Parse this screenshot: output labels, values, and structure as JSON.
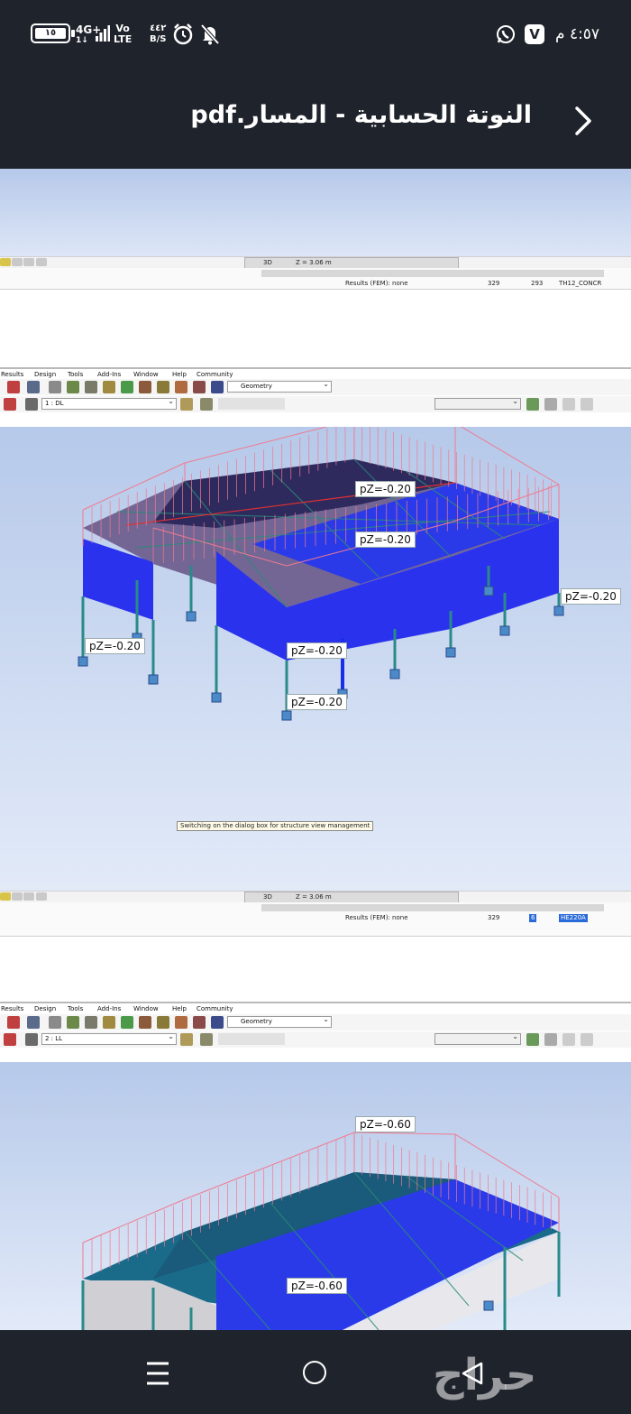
{
  "status_bar": {
    "battery": "١٥",
    "network_type": "4G+",
    "network_sub": "1↓",
    "volte_top": "Vo",
    "volte_bottom": "LTE",
    "speed_value": "٤٤٢",
    "speed_unit": "B/S",
    "clock": "٤:٥٧ م",
    "app_icons": [
      "whatsapp-icon",
      "v-app-icon"
    ],
    "left_icons": [
      "alarm-icon",
      "bell-off-icon"
    ]
  },
  "header": {
    "title": "النوتة الحسابية - المسار.pdf",
    "back_icon": "chevron-right-icon"
  },
  "doc": {
    "block1": {
      "tab_view": "3D",
      "tab_z": "Z = 3.06 m",
      "results": "Results (FEM): none",
      "num_a": "329",
      "num_b": "293",
      "section": "TH12_CONCR"
    },
    "menu": [
      "Results",
      "Design",
      "Tools",
      "Add-Ins",
      "Window",
      "Help",
      "Community"
    ],
    "geometry_combo": "Geometry",
    "block2": {
      "load_case": "1 : DL",
      "labels": [
        "pZ=-0.20",
        "pZ=-0.20",
        "pZ=-0.20",
        "pZ=-0.20",
        "pZ=-0.20",
        "pZ=-0.20"
      ],
      "tooltip": "Switching on the dialog box for structure view management",
      "tab_view": "3D",
      "tab_z": "Z = 3.06 m",
      "results": "Results (FEM): none",
      "num_a": "329",
      "num_b": "6",
      "section": "HE220A"
    },
    "block3": {
      "load_case": "2 : LL",
      "labels": [
        "pZ=-0.60",
        "pZ=-0.60"
      ]
    }
  },
  "nav": {
    "recent_icon": "recent-apps-icon",
    "home_icon": "home-icon",
    "back_icon": "back-triangle-icon",
    "watermark": "حراج"
  }
}
